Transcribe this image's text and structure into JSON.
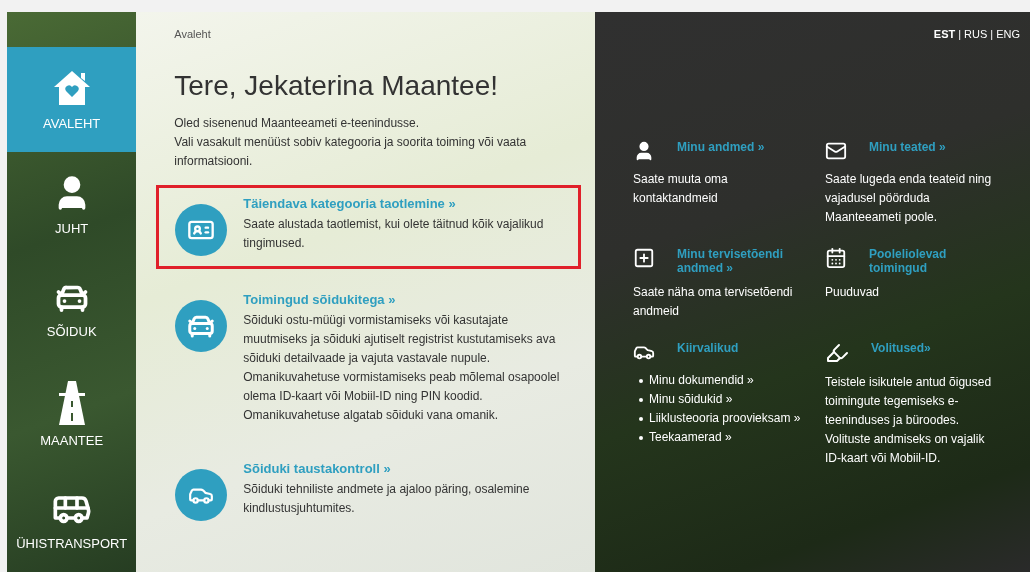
{
  "sidebar": {
    "items": [
      {
        "label": "AVALEHT",
        "selected": true
      },
      {
        "label": "JUHT",
        "selected": false
      },
      {
        "label": "SÕIDUK",
        "selected": false
      },
      {
        "label": "MAANTEE",
        "selected": false
      },
      {
        "label": "ÜHISTRANSPORT",
        "selected": false
      }
    ]
  },
  "breadcrumb": "Avaleht",
  "greeting": "Tere, Jekaterina Maantee!",
  "intro": [
    "Oled sisenenud Maanteeameti e-teenindusse.",
    "Vali vasakult menüüst sobiv kategooria ja soorita toiming või vaata informatsiooni."
  ],
  "services": [
    {
      "title": "Täiendava kategooria taotlemine »",
      "text": "Saate alustada taotlemist, kui olete täitnud kõik vajalikud tingimused.",
      "highlighted": true
    },
    {
      "title": "Toimingud sõidukitega »",
      "text": "Sõiduki ostu-müügi vormistamiseks või kasutajate muutmiseks ja sõiduki ajutiselt registrist kustutamiseks ava sõiduki detailvaade ja vajuta vastavale nupule. Omanikuvahetuse vormistamiseks peab mõlemal osapoolel olema ID-kaart või Mobiil-ID ning PIN koodid. Omanikuvahetuse algatab sõiduki vana omanik.",
      "highlighted": false
    },
    {
      "title": "Sõiduki taustakontroll »",
      "text": "Sõiduki tehniliste andmete ja ajaloo päring, osalemine kindlustusjuhtumites.",
      "highlighted": false
    }
  ],
  "languages": [
    {
      "label": "EST",
      "selected": true
    },
    {
      "label": "RUS",
      "selected": false
    },
    {
      "label": "ENG",
      "selected": false
    }
  ],
  "language_separator": "|",
  "panels": [
    {
      "kind": "text",
      "title": "Minu andmed »",
      "text": "Saate muuta oma kontaktandmeid"
    },
    {
      "kind": "text",
      "title": "Minu teated »",
      "text": "Saate lugeda enda teateid ning vajadusel pöörduda Maanteeameti poole."
    },
    {
      "kind": "text",
      "title": "Minu tervisetõendi andmed »",
      "text": "Saate näha oma tervisetõendi andmeid"
    },
    {
      "kind": "text",
      "title": "Pooleliolevad toimingud",
      "text": "Puuduvad"
    },
    {
      "kind": "links",
      "title": "Kiirvalikud",
      "links": [
        "Minu dokumendid »",
        "Minu sõidukid »",
        "Liiklusteooria proovieksam »",
        "Teekaamerad »"
      ]
    },
    {
      "kind": "text",
      "title": "Volitused»",
      "text": "Teistele isikutele antud õigused toimingute tegemiseks e-teeninduses ja büroodes. Volituste andmiseks on vajalik ID-kaart või Mobiil-ID."
    }
  ]
}
